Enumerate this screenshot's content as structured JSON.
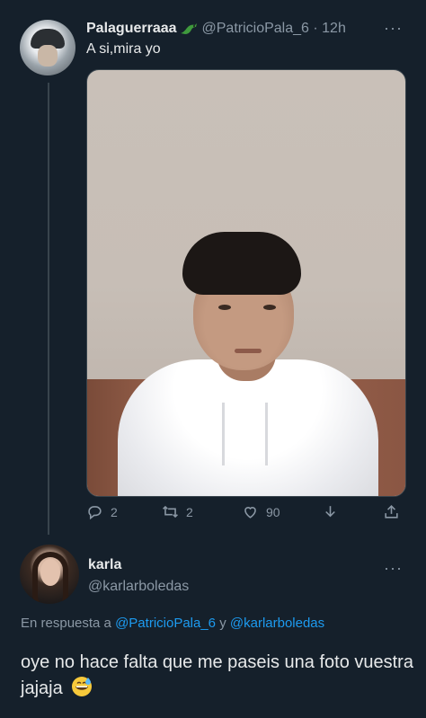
{
  "tweet": {
    "display_name": "Palaguerraaa",
    "name_emoji": "dragon-emoji",
    "handle": "@PatricioPala_6",
    "separator": " · ",
    "time": "12h",
    "more": "···",
    "text": "A si,mira yo",
    "photo": "portrait-young-man-white-hoodie",
    "actions": {
      "replies": "2",
      "retweets": "2",
      "likes": "90"
    }
  },
  "reply": {
    "display_name": "karla",
    "handle": "@karlarboledas",
    "more": "···",
    "reply_prefix": "En respuesta a ",
    "reply_user1": "@PatricioPala_6",
    "reply_and": " y ",
    "reply_user2": "@karlarboledas",
    "text": "oye no hace falta que me paseis una foto vuestra jajaja",
    "text_emoji": "grinning-sweat-emoji"
  },
  "colors": {
    "background": "#15202b",
    "text": "#e7e9ea",
    "muted": "#8b98a5",
    "link": "#1d9bf0"
  }
}
